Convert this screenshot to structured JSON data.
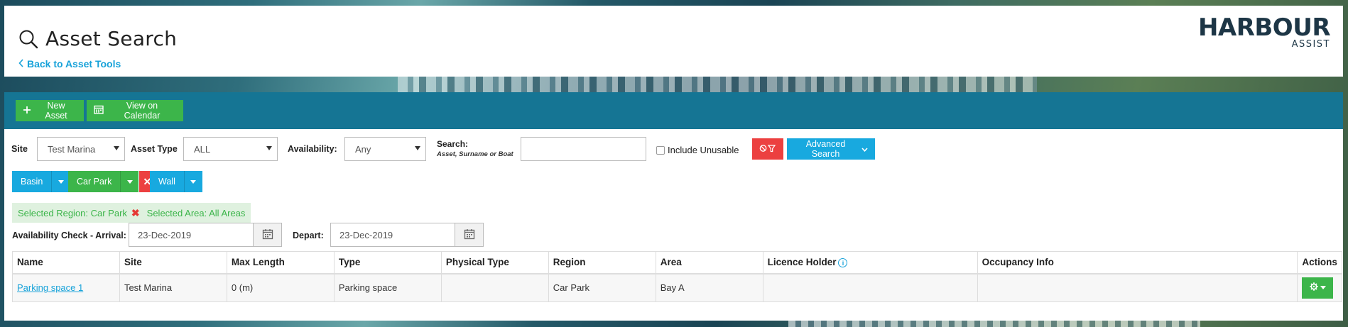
{
  "header": {
    "title": "Asset Search",
    "back_link": "Back to Asset Tools",
    "logo_main": "HARBOUR",
    "logo_sub": "ASSIST"
  },
  "toolbar": {
    "new_asset_label": "New Asset",
    "view_calendar_label": "View on Calendar"
  },
  "filters": {
    "site_label": "Site",
    "site_value": "Test Marina",
    "asset_type_label": "Asset Type",
    "asset_type_value": "ALL",
    "availability_label": "Availability:",
    "availability_value": "Any",
    "search_label": "Search:",
    "search_hint": "Asset, Surname or Boat",
    "search_value": "",
    "include_unusable_label": "Include Unusable",
    "advanced_search_label": "Advanced Search"
  },
  "regions": [
    {
      "label": "Basin",
      "color": "#18a9df"
    },
    {
      "label": "Car Park",
      "color": "#3cb54a"
    },
    {
      "label": "Wall",
      "color": "#18a9df"
    }
  ],
  "selection": {
    "region_text": "Selected Region: Car Park",
    "area_text": "Selected Area: All Areas"
  },
  "availability_check": {
    "arrival_label": "Availability Check - Arrival:",
    "arrival_value": "23-Dec-2019",
    "depart_label": "Depart:",
    "depart_value": "23-Dec-2019"
  },
  "table": {
    "headers": [
      "Name",
      "Site",
      "Max Length",
      "Type",
      "Physical Type",
      "Region",
      "Area",
      "Licence Holder",
      "Occupancy Info",
      "Actions"
    ],
    "rows": [
      {
        "name": "Parking space 1",
        "site": "Test Marina",
        "max_length": "0 (m)",
        "type": "Parking space",
        "physical_type": "",
        "region": "Car Park",
        "area": "Bay A",
        "licence_holder": "",
        "occupancy_info": ""
      }
    ]
  },
  "colors": {
    "accent_blue": "#18a9df",
    "accent_green": "#3cb54a",
    "danger_red": "#ec4040",
    "band_teal": "#157594"
  }
}
